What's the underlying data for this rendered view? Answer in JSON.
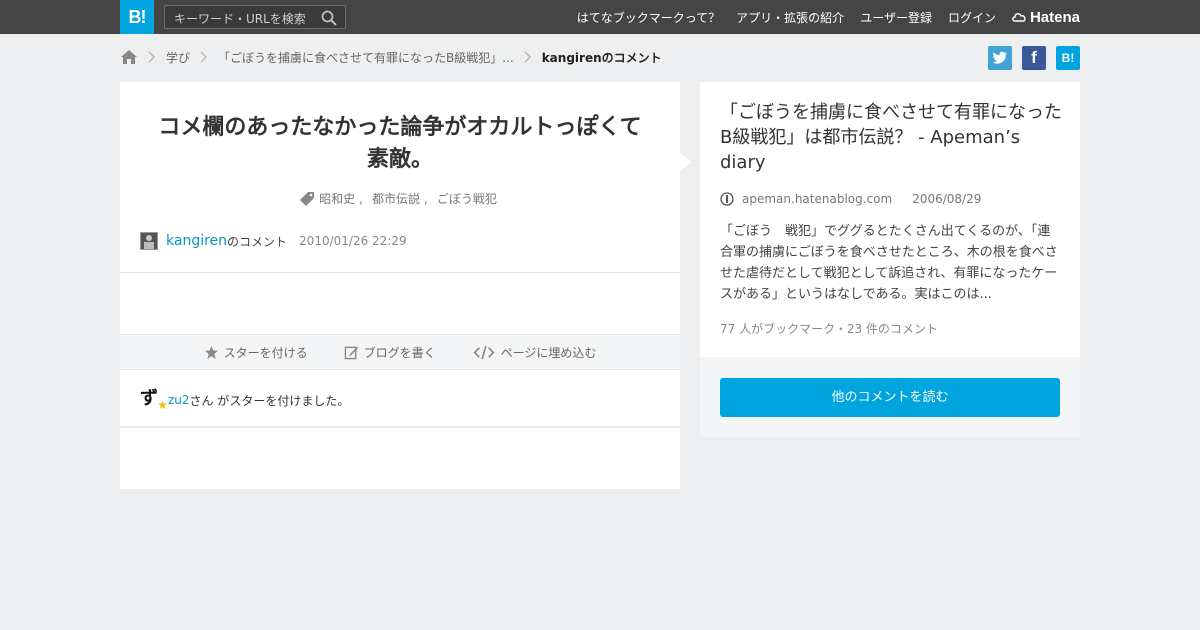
{
  "header": {
    "logo_text": "B!",
    "search_placeholder": "キーワード・URLを検索",
    "nav": [
      "はてなブックマークって？",
      "アプリ・拡張の紹介",
      "ユーザー登録",
      "ログイン"
    ],
    "brand": "Hatena"
  },
  "breadcrumb": {
    "category": "学び",
    "entry": "「ごぼうを捕虜に食べさせて有罪になったB級戦犯」...",
    "current": "kangirenのコメント"
  },
  "share": {
    "facebook_glyph": "f",
    "hatena_glyph": "B!"
  },
  "comment": {
    "text": "コメ欄のあったなかった論争がオカルトっぽくて素敵。",
    "tags": [
      "昭和史",
      "都市伝説",
      "ごぼう戦犯"
    ],
    "author": "kangiren",
    "author_suffix": "のコメント",
    "date": "2010/01/26 22:29"
  },
  "actions": {
    "star": "スターを付ける",
    "blog": "ブログを書く",
    "embed": "ページに埋め込む"
  },
  "star_notice": {
    "avatar_char": "ず",
    "user": "zu2",
    "text": "さん がスターを付けました。"
  },
  "entry": {
    "title": "「ごぼうを捕虜に食べさせて有罪になったB級戦犯」は都市伝説？ - Apeman’s diary",
    "domain": "apeman.hatenablog.com",
    "date": "2006/08/29",
    "summary": "「ごぼう　戦犯」でググるとたくさん出てくるのが、「連合軍の捕虜にごぼうを食べさせたところ、木の根を食べさせた虐待だとして戦犯として訴追され、有罪になったケースがある」というはなしである。実はこのは...",
    "stats": "77 人がブックマーク・23 件のコメント",
    "read_more": "他のコメントを読む"
  },
  "colors": {
    "accent": "#00a4de",
    "topbar": "#454545",
    "link": "#0a94c4",
    "background": "#edeff0"
  }
}
